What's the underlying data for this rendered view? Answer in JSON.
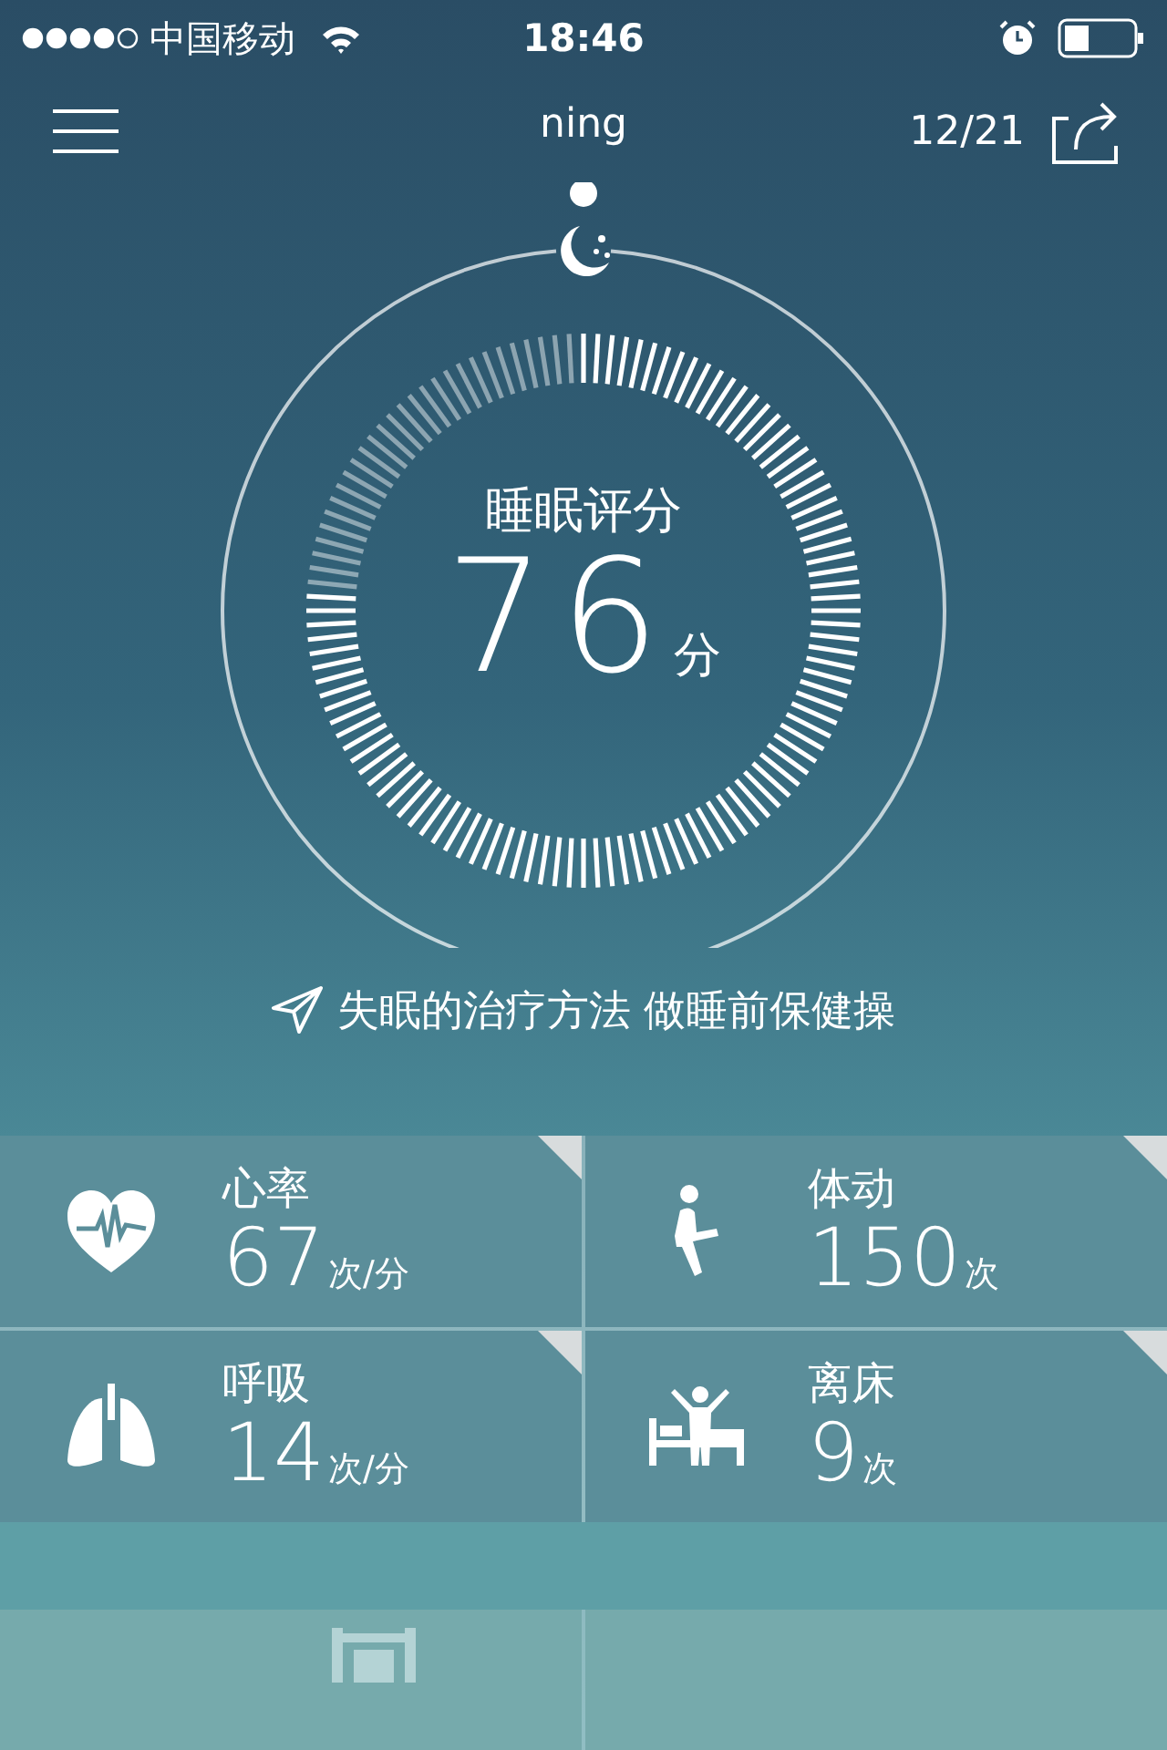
{
  "status_bar": {
    "carrier": "中国移动",
    "time": "18:46"
  },
  "header": {
    "title": "ning",
    "date": "12/21"
  },
  "score": {
    "label": "睡眠评分",
    "value": "76",
    "unit": "分"
  },
  "tip": "失眠的治疗方法 做睡前保健操",
  "metrics": [
    {
      "kind": "heart",
      "label": "心率",
      "value": "67",
      "unit": "次/分"
    },
    {
      "kind": "movement",
      "label": "体动",
      "value": "150",
      "unit": "次"
    },
    {
      "kind": "breath",
      "label": "呼吸",
      "value": "14",
      "unit": "次/分"
    },
    {
      "kind": "leave",
      "label": "离床",
      "value": "9",
      "unit": "次"
    }
  ]
}
